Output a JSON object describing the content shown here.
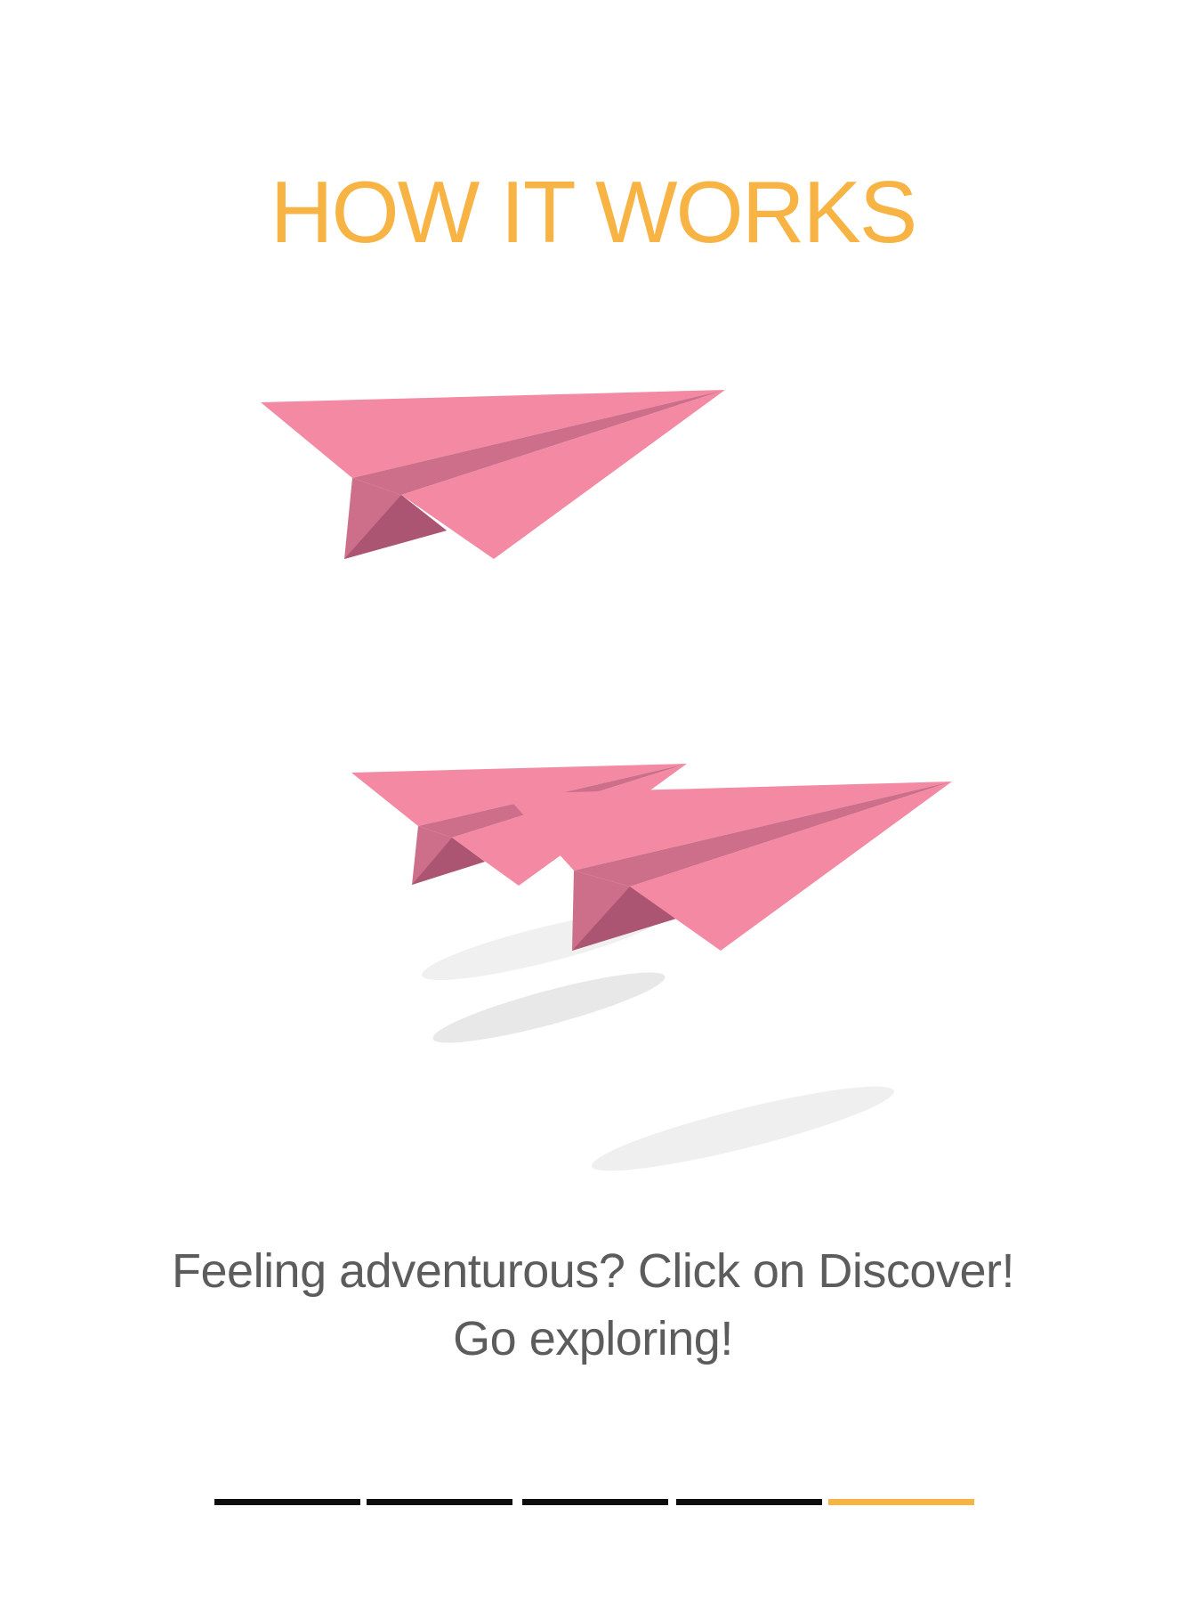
{
  "header": {
    "title": "HOW IT WORKS"
  },
  "illustration": {
    "icon": "paper-planes-icon"
  },
  "caption": {
    "line1": "Feeling adventurous? Click on Discover!",
    "line2": "Go exploring!"
  },
  "pager": {
    "total_steps": 5,
    "current_step": 5
  },
  "colors": {
    "accent": "#f7b445",
    "text": "#5c5c5c",
    "inactive_dash": "#0d0d0d",
    "plane_light": "#f389a2",
    "plane_mid": "#cd6f8a",
    "plane_dark": "#ab5573",
    "shadow": "#e8e8e8"
  }
}
